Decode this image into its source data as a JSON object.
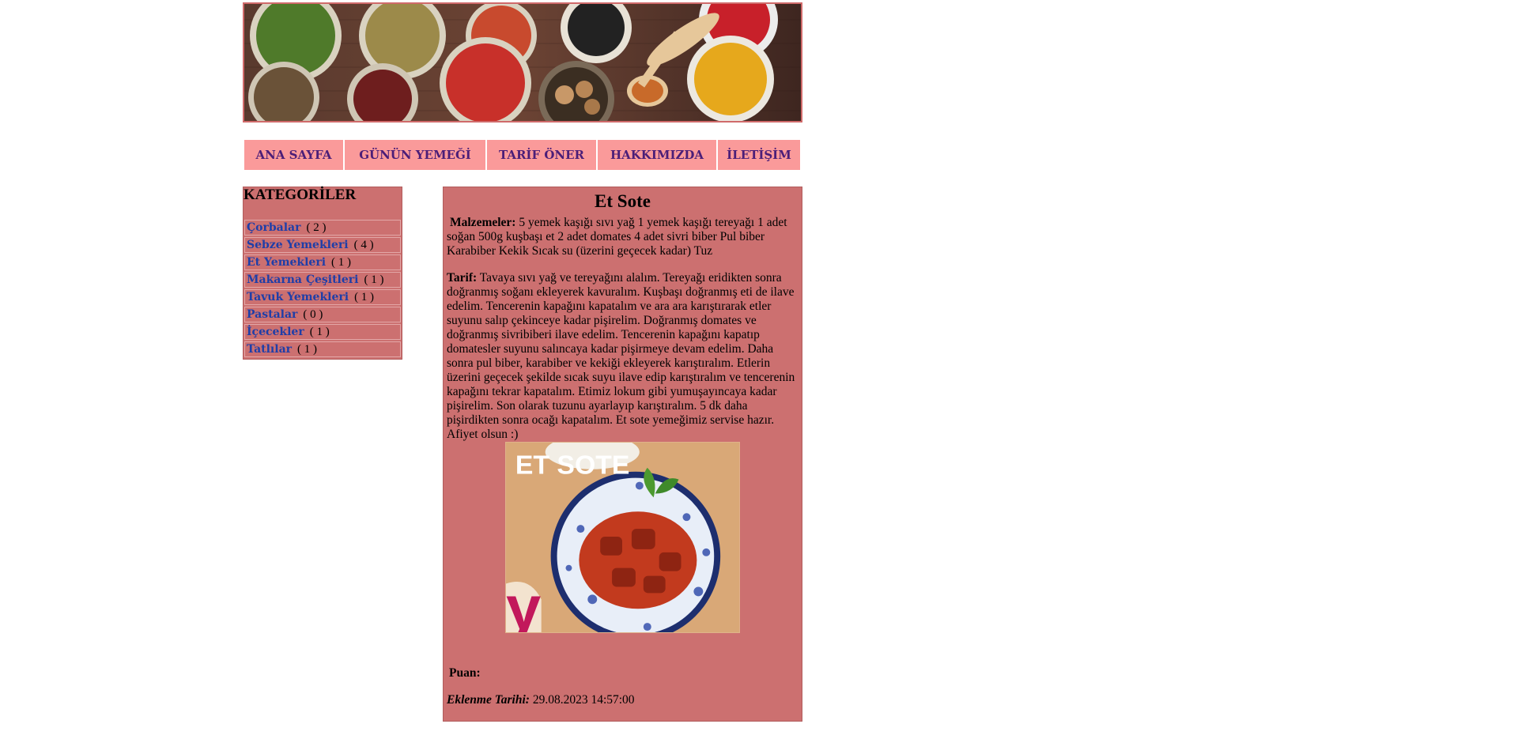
{
  "nav": {
    "items": [
      {
        "label": "ANA SAYFA"
      },
      {
        "label": "GÜNÜN YEMEĞİ"
      },
      {
        "label": "TARİF ÖNER"
      },
      {
        "label": "HAKKIMIZDA"
      },
      {
        "label": "İLETİŞİM"
      }
    ]
  },
  "sidebar": {
    "title": "KATEGORİLER",
    "categories": [
      {
        "name": "Çorbalar",
        "count": "( 2 )"
      },
      {
        "name": "Sebze Yemekleri",
        "count": "( 4 )"
      },
      {
        "name": "Et Yemekleri",
        "count": "( 1 )"
      },
      {
        "name": "Makarna Çeşitleri",
        "count": "( 1 )"
      },
      {
        "name": "Tavuk Yemekleri",
        "count": "( 1 )"
      },
      {
        "name": "Pastalar",
        "count": "( 0 )"
      },
      {
        "name": "İçecekler",
        "count": "( 1 )"
      },
      {
        "name": "Tatlılar",
        "count": "( 1 )"
      }
    ]
  },
  "recipe": {
    "title": "Et Sote",
    "ingredients_label": "Malzemeler:",
    "ingredients": "5 yemek kaşığı sıvı yağ 1 yemek kaşığı tereyağı 1 adet soğan 500g kuşbaşı et 2 adet domates 4 adet sivri biber Pul biber Karabiber Kekik Sıcak su (üzerini geçecek kadar) Tuz",
    "instructions_label": "Tarif:",
    "instructions": "Tavaya sıvı yağ ve tereyağını alalım. Tereyağı eridikten sonra doğranmış soğanı ekleyerek kavuralım. Kuşbaşı doğranmış eti de ilave edelim. Tencerenin kapağını kapatalım ve ara ara karıştırarak etler suyunu salıp çekinceye kadar pişirelim. Doğranmış domates ve doğranmış sivribiberi ilave edelim. Tencerenin kapağını kapatıp domatesler suyunu salıncaya kadar pişirmeye devam edelim. Daha sonra pul biber, karabiber ve kekiği ekleyerek karıştıralım. Etlerin üzerini geçecek şekilde sıcak suyu ilave edip karıştıralım ve tencerenin kapağını tekrar kapatalım. Etimiz lokum gibi yumuşayıncaya kadar pişirelim. Son olarak tuzunu ayarlayıp karıştıralım. 5 dk daha pişirdikten sonra ocağı kapatalım. Et sote yemeğimiz servise hazır. Afiyet olsun :)",
    "image_text": "ET SOTE",
    "image_logo": "y",
    "rating_label": "Puan:",
    "date_label": "Eklenme Tarihi:",
    "date_value": "29.08.2023 14:57:00"
  }
}
